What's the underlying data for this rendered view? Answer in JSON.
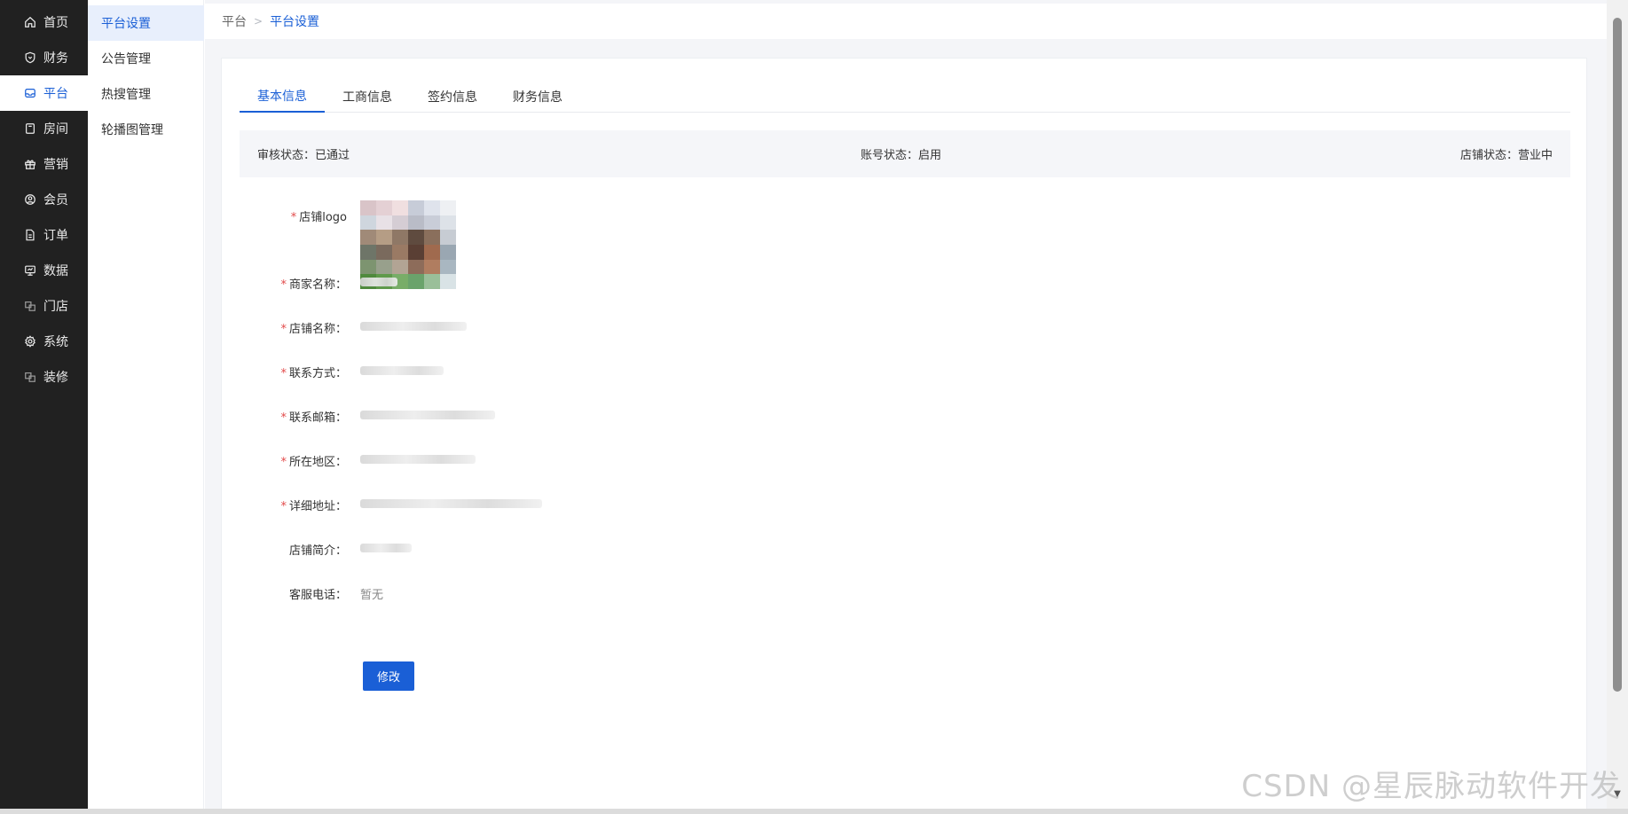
{
  "nav": {
    "items": [
      {
        "label": "首页",
        "icon": "home-icon"
      },
      {
        "label": "财务",
        "icon": "shield-icon"
      },
      {
        "label": "平台",
        "icon": "inbox-icon"
      },
      {
        "label": "房间",
        "icon": "room-icon"
      },
      {
        "label": "营销",
        "icon": "gift-icon"
      },
      {
        "label": "会员",
        "icon": "user-icon"
      },
      {
        "label": "订单",
        "icon": "document-icon"
      },
      {
        "label": "数据",
        "icon": "monitor-icon"
      },
      {
        "label": "门店",
        "icon": "store-icon"
      },
      {
        "label": "系统",
        "icon": "gear-icon"
      },
      {
        "label": "装修",
        "icon": "decor-icon"
      }
    ],
    "active_index": 2
  },
  "submenu": {
    "items": [
      "平台设置",
      "公告管理",
      "热搜管理",
      "轮播图管理"
    ],
    "active_index": 0
  },
  "breadcrumb": {
    "root": "平台",
    "current": "平台设置"
  },
  "tabs": {
    "items": [
      "基本信息",
      "工商信息",
      "签约信息",
      "财务信息"
    ],
    "active_index": 0
  },
  "status": {
    "review": "审核状态：已通过",
    "account": "账号状态：启用",
    "store": "店铺状态：营业中"
  },
  "form": {
    "logo_label": "店铺logo",
    "merchant_label": "商家名称：",
    "store_label": "店铺名称：",
    "contact_label": "联系方式：",
    "email_label": "联系邮箱：",
    "region_label": "所在地区：",
    "address_label": "详细地址：",
    "intro_label": "店铺简介：",
    "service_label": "客服电话：",
    "service_value": "暂无",
    "edit_button": "修改"
  },
  "watermark": "CSDN @星辰脉动软件开发",
  "colors": {
    "accent": "#1a5fd6",
    "nav_bg": "#212121",
    "required": "#e24a4a"
  }
}
